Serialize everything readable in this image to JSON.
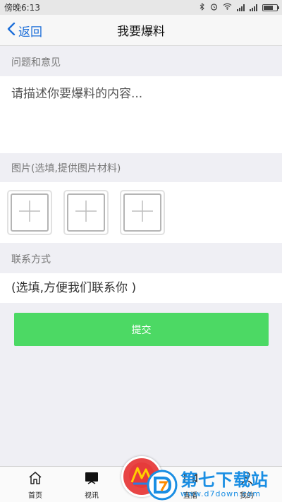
{
  "status_bar": {
    "time": "傍晚6:13",
    "icons": [
      "bluetooth-icon",
      "alarm-icon",
      "wifi-icon",
      "signal-icon",
      "battery-icon"
    ]
  },
  "header": {
    "back_label": "返回",
    "title": "我要爆料"
  },
  "feedback": {
    "label": "问题和意见",
    "placeholder": "请描述你要爆料的内容..."
  },
  "photos": {
    "label": "图片(选填,提供图片材料)",
    "slots": 3
  },
  "contact": {
    "label": "联系方式",
    "placeholder": "(选填,方便我们联系你 )"
  },
  "submit_label": "提交",
  "tabs": [
    {
      "label": "首页",
      "icon": "home-icon"
    },
    {
      "label": "视讯",
      "icon": "tv-icon"
    },
    {
      "label": "直播",
      "icon": "live-icon"
    },
    {
      "label": "我的",
      "icon": "user-icon"
    }
  ],
  "watermark": {
    "name": "第七下载站",
    "url": "www.d7down.com"
  },
  "colors": {
    "accent": "#1e6fd9",
    "submit": "#4cd964",
    "background": "#efeff4",
    "watermark": "#1a8ee3"
  }
}
